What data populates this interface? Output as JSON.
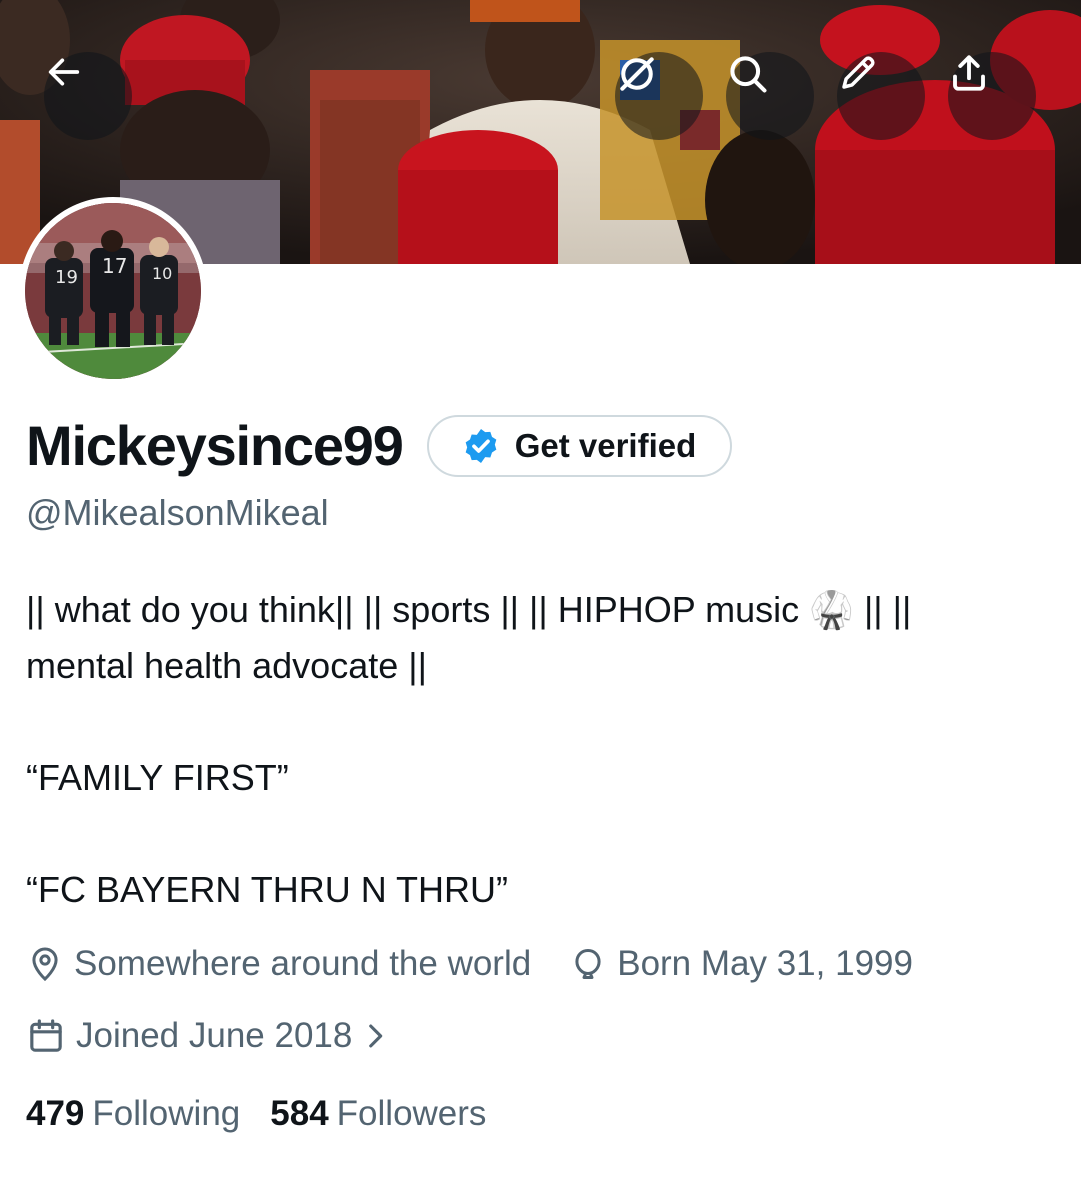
{
  "profile": {
    "display_name": "Mickeysince99",
    "handle": "@MikealsonMikeal",
    "get_verified_label": "Get verified",
    "bio_lines": [
      "|| what do you think|| || sports || || HIPHOP music 🥋 || ||",
      "mental health advocate ||",
      "“FAMILY FIRST”",
      "“FC BAYERN THRU N THRU”"
    ],
    "location": "Somewhere around the world",
    "birthday": "Born May 31, 1999",
    "joined": "Joined June 2018",
    "following_count": "479",
    "following_label": "Following",
    "followers_count": "584",
    "followers_label": "Followers"
  },
  "avatar_jerseys": [
    "19",
    "17",
    "10"
  ],
  "icons": {
    "back": "arrow-left-icon",
    "grok": "slashed-circle-icon",
    "search": "search-icon",
    "edit": "pencil-icon",
    "share": "share-upload-icon",
    "location": "location-pin-icon",
    "birthday": "balloon-icon",
    "joined": "calendar-icon",
    "chevron": "chevron-right-icon",
    "verified": "verified-badge-icon"
  },
  "colors": {
    "accent_blue": "#1d9bf0",
    "text_primary": "#0f1419",
    "text_secondary": "#536471",
    "border": "#cfd9de"
  }
}
